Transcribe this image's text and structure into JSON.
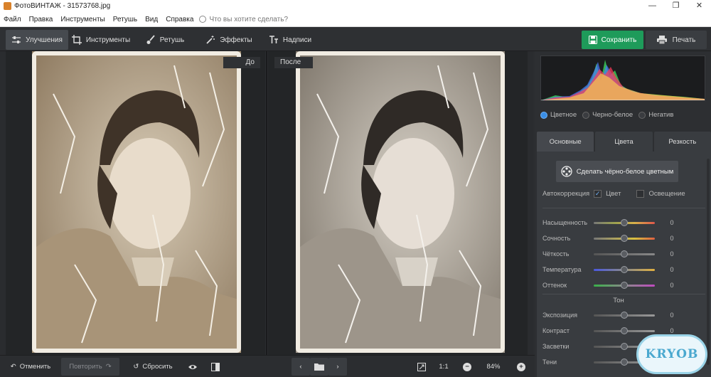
{
  "window": {
    "title": "ФотоВИНТАЖ - 31573768.jpg",
    "min": "—",
    "max": "❐",
    "close": "✕"
  },
  "menu": {
    "items": [
      "Файл",
      "Правка",
      "Инструменты",
      "Ретушь",
      "Вид",
      "Справка"
    ],
    "search_placeholder": "Что вы хотите сделать?"
  },
  "toolbar": {
    "tabs": [
      {
        "label": "Улучшения",
        "icon": "sliders-icon",
        "active": true
      },
      {
        "label": "Инструменты",
        "icon": "crop-icon",
        "active": false
      },
      {
        "label": "Ретушь",
        "icon": "brush-icon",
        "active": false
      },
      {
        "label": "Эффекты",
        "icon": "magic-wand-icon",
        "active": false
      },
      {
        "label": "Надписи",
        "icon": "text-icon",
        "active": false
      }
    ],
    "save_label": "Сохранить",
    "print_label": "Печать"
  },
  "canvas": {
    "before_label": "До",
    "after_label": "После"
  },
  "panel": {
    "modes": [
      {
        "label": "Цветное",
        "selected": true
      },
      {
        "label": "Черно-белое",
        "selected": false
      },
      {
        "label": "Негатив",
        "selected": false
      }
    ],
    "tabs": [
      {
        "label": "Основные",
        "active": true
      },
      {
        "label": "Цвета",
        "active": false
      },
      {
        "label": "Резкость",
        "active": false
      }
    ],
    "colorize_label": "Сделать чёрно-белое цветным",
    "autocorrection_label": "Автокоррекция",
    "auto_color_label": "Цвет",
    "auto_color_checked": true,
    "auto_light_label": "Освещение",
    "auto_light_checked": false,
    "tone_section": "Тон",
    "sliders": [
      {
        "name": "Насыщенность",
        "value": "0"
      },
      {
        "name": "Сочность",
        "value": "0"
      },
      {
        "name": "Чёткость",
        "value": "0"
      },
      {
        "name": "Температура",
        "value": "0"
      },
      {
        "name": "Оттенок",
        "value": "0"
      }
    ],
    "tone_sliders": [
      {
        "name": "Экспозиция",
        "value": "0"
      },
      {
        "name": "Контраст",
        "value": "0"
      },
      {
        "name": "Засветки",
        "value": "0"
      },
      {
        "name": "Тени",
        "value": "0"
      }
    ]
  },
  "bottombar": {
    "undo_label": "Отменить",
    "redo_label": "Повторить",
    "reset_label": "Сбросить",
    "zoom_1to1": "1:1",
    "zoom_value": "84%"
  },
  "watermark": {
    "text": "KRYOB"
  }
}
